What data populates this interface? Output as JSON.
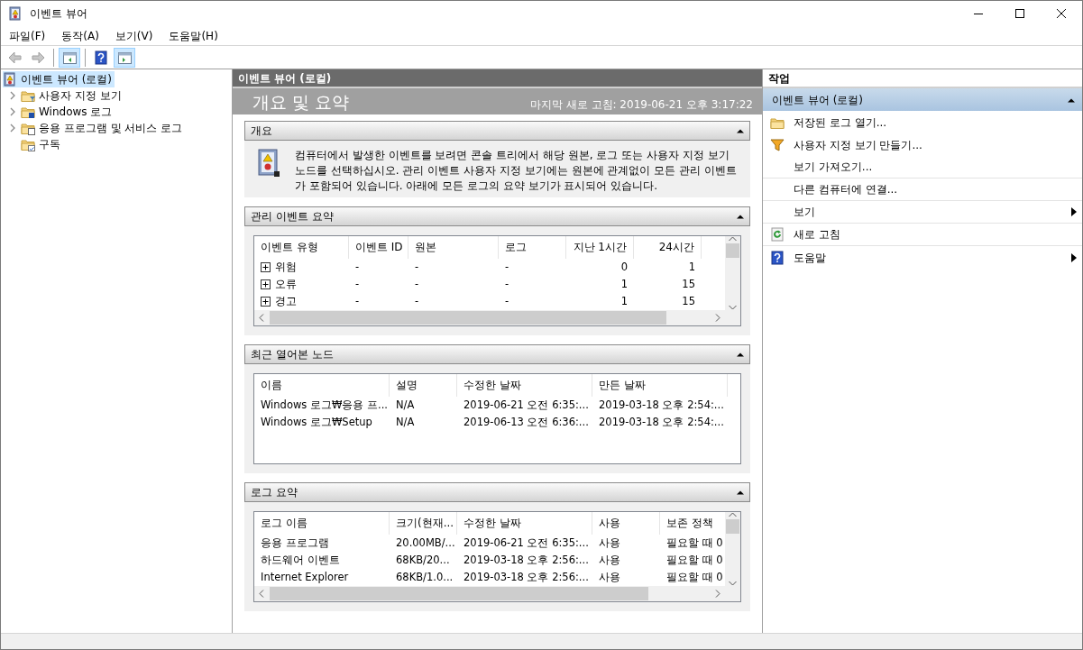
{
  "window": {
    "title": "이벤트 뷰어"
  },
  "menu": [
    "파일(F)",
    "동작(A)",
    "보기(V)",
    "도움말(H)"
  ],
  "toolbar": [
    {
      "kind": "back",
      "disabled": true
    },
    {
      "kind": "forward",
      "disabled": true
    },
    {
      "kind": "tree-pane",
      "on": true
    },
    {
      "kind": "help",
      "on": false
    },
    {
      "kind": "action-pane",
      "on": true
    }
  ],
  "tree": {
    "label": "이벤트 뷰어 (로컬)",
    "selected": true,
    "children": [
      {
        "label": "사용자 지정 보기",
        "kind": "filter-folder",
        "expandable": true,
        "selected": false
      },
      {
        "label": "Windows 로그",
        "kind": "windows-folder",
        "expandable": true,
        "selected": false
      },
      {
        "label": "응용 프로그램 및 서비스 로그",
        "kind": "app-folder",
        "expandable": true,
        "selected": false
      },
      {
        "label": "구독",
        "kind": "subscription-folder",
        "expandable": false,
        "selected": false
      }
    ]
  },
  "center": {
    "header": "이벤트 뷰어 (로컬)",
    "title": "개요 및 요약",
    "refresh": "마지막 새로 고침: 2019-06-21 오후 3:17:22",
    "overview": {
      "title": "개요",
      "expanded": true,
      "text": "컴퓨터에서 발생한 이벤트를 보려면 콘솔 트리에서 해당 원본, 로그 또는 사용자 지정 보기 노드를 선택하십시오. 관리 이벤트 사용자 지정 보기에는 원본에 관계없이 모든 관리 이벤트가 포함되어 있습니다. 아래에 모든 로그의 요약 보기가 표시되어 있습니다."
    },
    "tables": [
      {
        "title": "관리 이벤트 요약",
        "expanded": true,
        "scrollbars": true,
        "columns": [
          "이벤트 유형",
          "이벤트 ID",
          "원본",
          "로그",
          "지난 1시간",
          "24시간"
        ],
        "rows": [
          {
            "expanded": false,
            "cells": [
              "위험",
              "-",
              "-",
              "-",
              "0",
              "1"
            ]
          },
          {
            "expanded": false,
            "cells": [
              "오류",
              "-",
              "-",
              "-",
              "1",
              "15"
            ]
          },
          {
            "expanded": false,
            "cells": [
              "경고",
              "-",
              "-",
              "-",
              "1",
              "15"
            ]
          }
        ]
      },
      {
        "title": "최근 열어본 노드",
        "expanded": true,
        "scrollbars": false,
        "columns": [
          "이름",
          "설명",
          "수정한 날짜",
          "만든 날짜"
        ],
        "rows": [
          {
            "cells": [
              "Windows 로그₩응용 프...",
              "N/A",
              "2019-06-21 오전 6:35:...",
              "2019-03-18 오후 2:54:..."
            ]
          },
          {
            "cells": [
              "Windows 로그₩Setup",
              "N/A",
              "2019-06-13 오전 6:36:...",
              "2019-03-18 오후 2:54:..."
            ]
          }
        ]
      },
      {
        "title": "로그 요약",
        "expanded": true,
        "scrollbars": true,
        "columns": [
          "로그 이름",
          "크기(현재...",
          "수정한 날짜",
          "사용",
          "보존 정책"
        ],
        "rows": [
          {
            "cells": [
              "응용 프로그램",
              "20.00MB/...",
              "2019-06-21 오전 6:35:...",
              "사용",
              "필요할 때 0"
            ]
          },
          {
            "cells": [
              "하드웨어 이벤트",
              "68KB/20...",
              "2019-03-18 오후 2:56:...",
              "사용",
              "필요할 때 0"
            ]
          },
          {
            "cells": [
              "Internet Explorer",
              "68KB/1.0...",
              "2019-03-18 오후 2:56:...",
              "사용",
              "필요할 때 0"
            ]
          }
        ]
      }
    ]
  },
  "actions": {
    "title": "작업",
    "group": {
      "label": "이벤트 뷰어 (로컬)",
      "expanded": true
    },
    "items": [
      {
        "label": "저장된 로그 열기...",
        "kind": "folder",
        "submenu": false,
        "divider": false
      },
      {
        "label": "사용자 지정 보기 만들기...",
        "kind": "filter",
        "submenu": false,
        "divider": false
      },
      {
        "label": "보기 가져오기...",
        "kind": "plain",
        "submenu": false,
        "divider": true
      },
      {
        "label": "다른 컴퓨터에 연결...",
        "kind": "plain",
        "submenu": false,
        "divider": true
      },
      {
        "label": "보기",
        "kind": "plain",
        "submenu": true,
        "divider": true
      },
      {
        "label": "새로 고침",
        "kind": "refresh",
        "submenu": false,
        "divider": true
      },
      {
        "label": "도움말",
        "kind": "help",
        "submenu": true,
        "divider": false
      }
    ]
  }
}
